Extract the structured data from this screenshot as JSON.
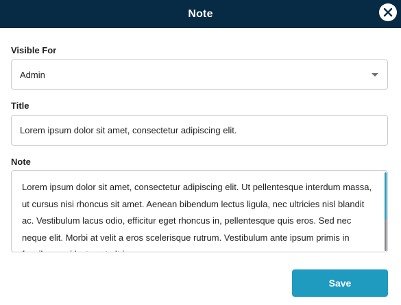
{
  "modal": {
    "title": "Note",
    "close_icon": "close-icon"
  },
  "form": {
    "visible_for_label": "Visible For",
    "visible_for_value": "Admin",
    "title_label": "Title",
    "title_value": "Lorem ipsum dolor sit amet, consectetur adipiscing elit.",
    "note_label": "Note",
    "note_value": "Lorem ipsum dolor sit amet, consectetur adipiscing elit. Ut pellentesque interdum massa, ut cursus nisi rhoncus sit amet. Aenean bibendum lectus ligula, nec ultricies nisl blandit ac. Vestibulum lacus odio, efficitur eget rhoncus in, pellentesque quis eros. Sed nec neque elit. Morbi at velit a eros scelerisque rutrum. Vestibulum ante ipsum primis in faucibus orci luctus et ultrices"
  },
  "actions": {
    "save_label": "Save"
  },
  "colors": {
    "header_bg": "#072a45",
    "accent": "#1f9bbf"
  }
}
